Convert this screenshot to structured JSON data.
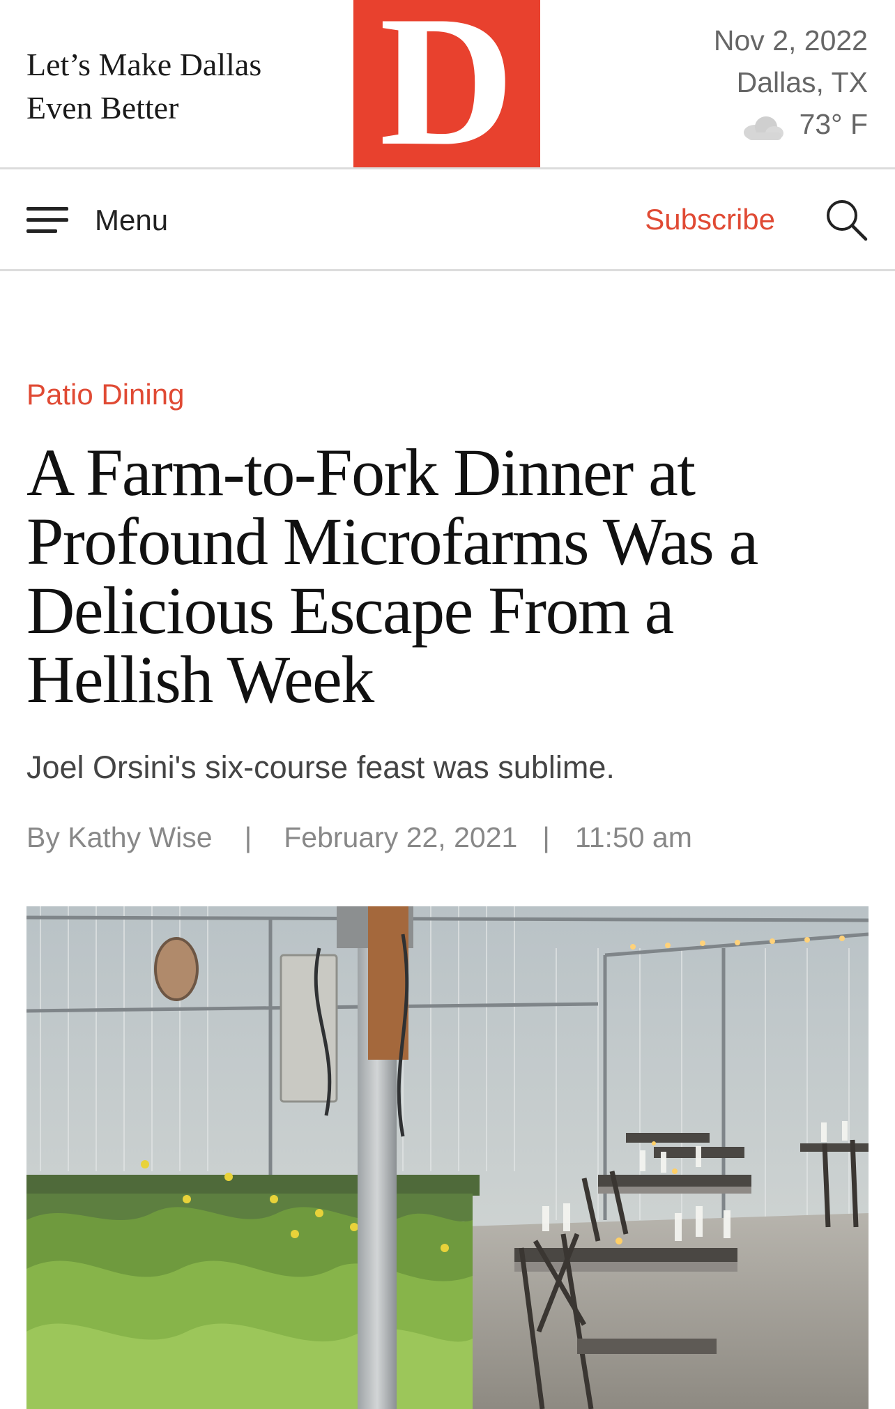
{
  "header": {
    "tagline_line1": "Let’s Make Dallas",
    "tagline_line2": "Even Better",
    "logo_letter": "D",
    "date": "Nov 2, 2022",
    "location": "Dallas, TX",
    "temperature": "73° F",
    "weather_icon": "cloud-icon"
  },
  "nav": {
    "menu_label": "Menu",
    "subscribe_label": "Subscribe",
    "search_icon": "search-icon",
    "menu_icon": "hamburger-icon"
  },
  "article": {
    "category": "Patio Dining",
    "headline_lines": [
      "A Farm-to-Fork Dinner at",
      "Profound Microfarms Was a",
      "Delicious Escape From a",
      "Hellish Week"
    ],
    "dek": "Joel Orsini's six-course feast was sublime.",
    "author": "By Kathy Wise",
    "date": "February 22, 2021",
    "time": "11:50 am",
    "separator": "|"
  },
  "colors": {
    "brand_red": "#e8412e",
    "link_red": "#e04a34",
    "meta_gray": "#888888"
  }
}
